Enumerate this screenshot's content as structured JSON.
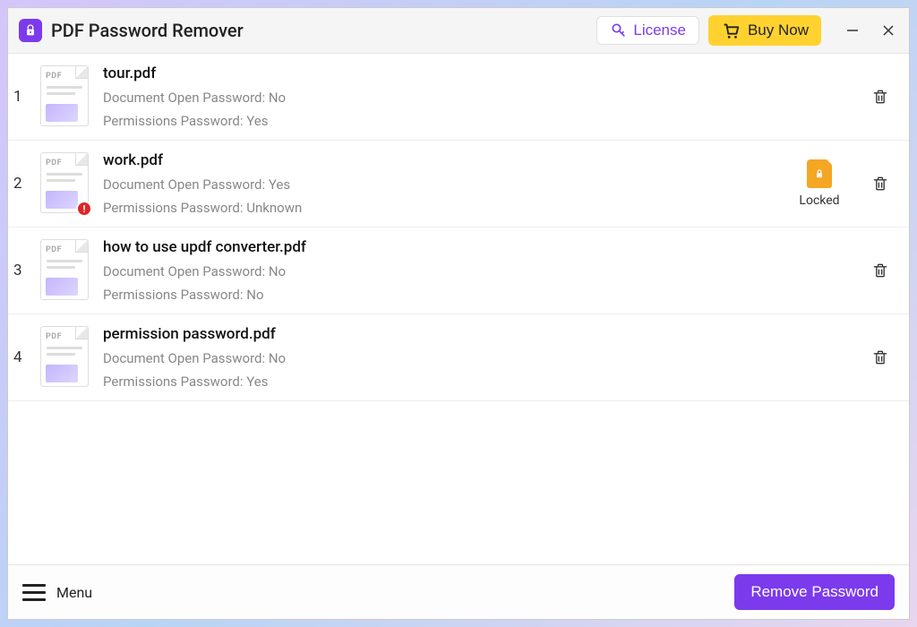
{
  "header": {
    "title": "PDF Password Remover",
    "license_label": "License",
    "buy_label": "Buy Now"
  },
  "files": [
    {
      "index": "1",
      "name": "tour.pdf",
      "doc_pw": "Document Open Password: No",
      "perm_pw": "Permissions Password: Yes",
      "alert": false,
      "locked": false,
      "locked_label": ""
    },
    {
      "index": "2",
      "name": "work.pdf",
      "doc_pw": "Document Open Password: Yes",
      "perm_pw": "Permissions Password: Unknown",
      "alert": true,
      "locked": true,
      "locked_label": "Locked"
    },
    {
      "index": "3",
      "name": "how to use updf converter.pdf",
      "doc_pw": "Document Open Password: No",
      "perm_pw": "Permissions Password: No",
      "alert": false,
      "locked": false,
      "locked_label": ""
    },
    {
      "index": "4",
      "name": "permission password.pdf",
      "doc_pw": "Document Open Password: No",
      "perm_pw": "Permissions Password: Yes",
      "alert": false,
      "locked": false,
      "locked_label": ""
    }
  ],
  "footer": {
    "menu_label": "Menu",
    "remove_label": "Remove Password"
  }
}
